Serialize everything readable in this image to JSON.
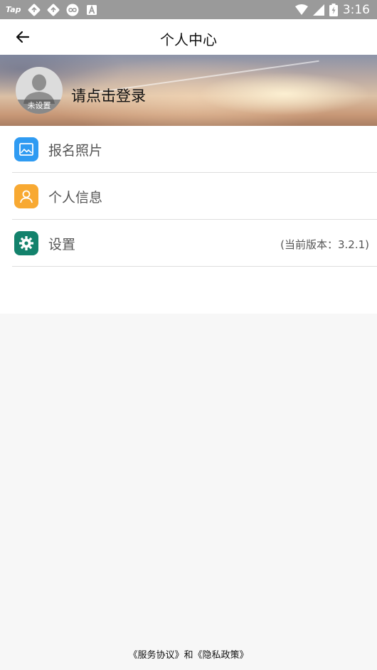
{
  "status_bar": {
    "tap": "Tap",
    "time": "3:16"
  },
  "header": {
    "title": "个人中心"
  },
  "profile": {
    "avatar_caption": "未设置",
    "login_prompt": "请点击登录"
  },
  "menu": {
    "items": [
      {
        "label": "报名照片",
        "icon": "image-icon",
        "color": "#2f9bf2"
      },
      {
        "label": "个人信息",
        "icon": "person-icon",
        "color": "#f8a932"
      },
      {
        "label": "设置",
        "icon": "gear-icon",
        "color": "#13826c",
        "note": "(当前版本：3.2.1)"
      }
    ]
  },
  "footer": {
    "service_agreement": "《服务协议》",
    "and": "和",
    "privacy_policy": "《隐私政策》"
  },
  "colors": {
    "status_bar": "#9a9a9a",
    "background": "#f7f7f7",
    "divider": "#dedede"
  }
}
